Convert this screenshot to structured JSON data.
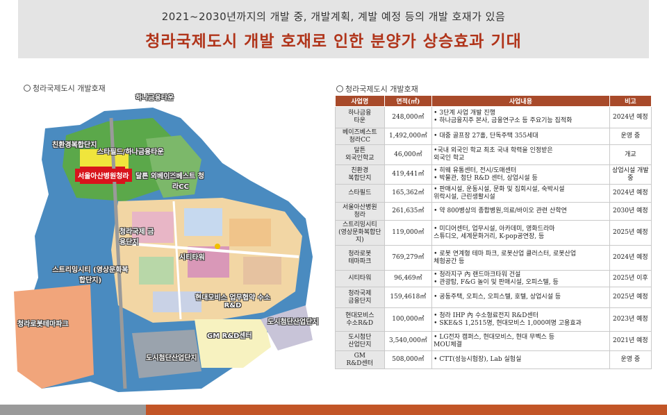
{
  "header": {
    "subtitle": "2021~2030년까지의 개발 중, 개발계획, 계발 예정 등의 개발 호재가 있음",
    "title": "청라국제도시 개발 호재로 인한 분양가 상승효과 기대"
  },
  "map_section": {
    "label": "청라국제도시 개발호재",
    "labels": {
      "hana": "하나금융타운",
      "eco": "친환경복합단지",
      "starfield": "스타필드/하나금융타운",
      "seoul_asan": "서울아산병원청라",
      "dalton": "달튼 외국인학교",
      "bestiest": "베이스베스트 청라CC",
      "finance": "청라국제 금융단지",
      "citytower": "시티타워",
      "streamcity": "스트리밍시티 (영상문화복합단지)",
      "hyundai": "현대모비스 업무협약 수소R&D",
      "robot": "청라로봇테마파크",
      "high_tech_right": "도시첨단산업단지",
      "gm": "GM R&D센터",
      "high_tech_bottom": "도시첨단산업단지"
    }
  },
  "table_section": {
    "label": "청라국제도시 개발호재",
    "headers": [
      "사업명",
      "면적(㎡)",
      "사업내용",
      "비고"
    ],
    "rows": [
      {
        "name": "하나금융\n타운",
        "area": "248,000㎡",
        "desc": "• 3단계 사업 개발 진행\n• 하나금융지주 본사, 금융연구소 등 주요기능 집적화",
        "note": "2024년 예정"
      },
      {
        "name": "베이즈베스트\n청라CC",
        "area": "1,492,000㎡",
        "desc": "• 대중 골프장 27홀, 단독주택 355세대",
        "note": "운영 중"
      },
      {
        "name": "달튼\n외국인학교",
        "area": "46,000㎡",
        "desc": "•국내 외국인 학교 최초 국내 학력을 인정받은\n  외국인 학교",
        "note": "개교"
      },
      {
        "name": "친환경\n복합단지",
        "area": "419,441㎡",
        "desc": "• 히웨 유통센터, 전시/도매센터\n• 박물관, 첨단 R&D 센터, 상업시설 등",
        "note": "상업시설 개발 중"
      },
      {
        "name": "스타필드",
        "area": "165,362㎡",
        "desc": "• 판매시설, 운동시설, 문화 및 집회시설, 숙박시설\n  위락시설, 근린생활시설",
        "note": "2024년 예정"
      },
      {
        "name": "서울아산병원\n청라",
        "area": "261,635㎡",
        "desc": "• 약 800병상의 종합병원,의료/바이오 관련 산학연",
        "note": "2030년 예정"
      },
      {
        "name": "스트리밍시티\n(영상문화복합단지)",
        "area": "119,000㎡",
        "desc": "• 미디어센터, 업무시설, 아카데미, 영화드라마\n  스튜디오, 세계문화거리, K-pop공연장, 등",
        "note": "2025년 예정"
      },
      {
        "name": "청라로봇\n테마파크",
        "area": "769,279㎡",
        "desc": "• 로봇 연계형 테마 파크, 로봇산업 클러스터, 로봇산업\n  체험공간 등",
        "note": "2024년 예정"
      },
      {
        "name": "시티타워",
        "area": "96,469㎡",
        "desc": "• 청라지구 內 랜드마크타워 건설\n• 관광탑, F&G 놀이 및 판매시설, 오피스텔, 등",
        "note": "2025년 이후"
      },
      {
        "name": "청라국제\n금융단지",
        "area": "159,4618㎡",
        "desc": "• 공동주택, 오피스, 오피스텔, 호텔, 상업시설 등",
        "note": "2025년 예정"
      },
      {
        "name": "현대모비스\n수소R&D",
        "area": "100,000㎡",
        "desc": "• 청라 IHP 內 수소형료전지 R&D센터\n• SKE&S 1,2515명, 현대모비스 1,000여명 고용효과",
        "note": "2023년 예정"
      },
      {
        "name": "도시첨단\n산업단지",
        "area": "3,540,000㎡",
        "desc": "• LG전자 캠퍼스, 현대모비스, 현대 무벡스 등\n  MOU체결",
        "note": "2021년 예정"
      },
      {
        "name": "GM\nR&D센터",
        "area": "508,000㎡",
        "desc": "• CTT(성능시험장), Lab 실험실",
        "note": "운영 중"
      }
    ]
  },
  "colors": {
    "accent": "#b0341a",
    "table_header": "#a84a2a",
    "footer_orange": "#c25527",
    "footer_gray": "#9a9a9a"
  }
}
